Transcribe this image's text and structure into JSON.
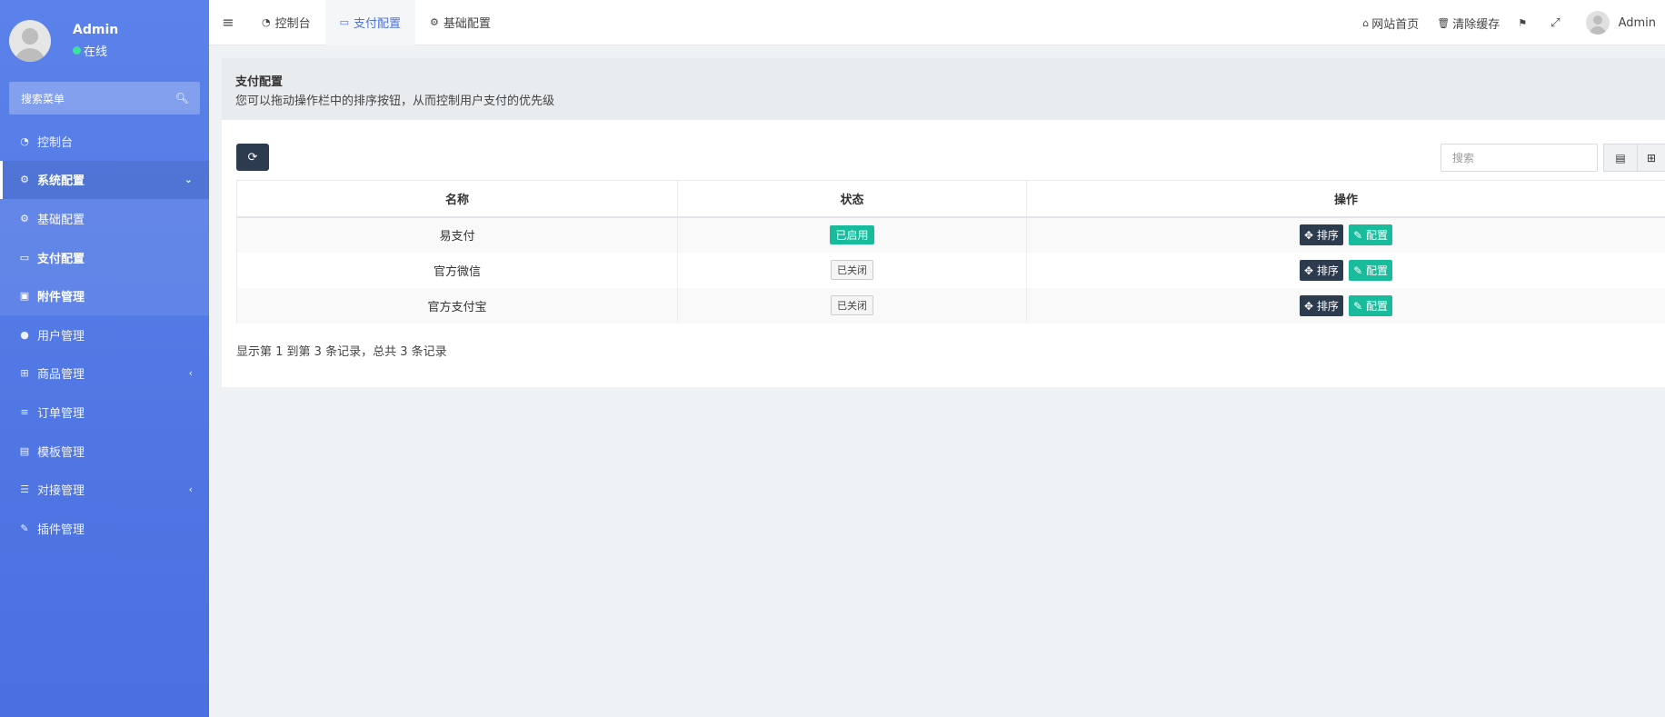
{
  "sidebar": {
    "user_name": "Admin",
    "user_status": "在线",
    "search_placeholder": "搜索菜单",
    "items": [
      {
        "label": "控制台",
        "icon": "dashboard-icon"
      },
      {
        "label": "系统配置",
        "icon": "gear-icon",
        "expanded": true
      },
      {
        "label": "基础配置",
        "icon": "gear-icon"
      },
      {
        "label": "支付配置",
        "icon": "credit-card-icon",
        "active": true
      },
      {
        "label": "附件管理",
        "icon": "image-icon"
      },
      {
        "label": "用户管理",
        "icon": "user-icon"
      },
      {
        "label": "商品管理",
        "icon": "cart-icon"
      },
      {
        "label": "订单管理",
        "icon": "list-icon"
      },
      {
        "label": "模板管理",
        "icon": "template-icon"
      },
      {
        "label": "对接管理",
        "icon": "sliders-icon"
      },
      {
        "label": "插件管理",
        "icon": "plug-icon"
      }
    ]
  },
  "topbar": {
    "tabs": [
      {
        "label": "控制台",
        "icon": "dashboard-icon"
      },
      {
        "label": "支付配置",
        "icon": "credit-card-icon",
        "active": true
      },
      {
        "label": "基础配置",
        "icon": "gear-icon"
      }
    ],
    "home_label": "网站首页",
    "clear_cache_label": "清除缓存",
    "user_name": "Admin"
  },
  "content_header": {
    "title": "支付配置",
    "description": "您可以拖动操作栏中的排序按钮，从而控制用户支付的优先级"
  },
  "toolbar": {
    "search_placeholder": "搜索"
  },
  "table": {
    "headers": [
      "名称",
      "状态",
      "操作"
    ],
    "rows": [
      {
        "name": "易支付",
        "status": "已启用",
        "enabled": true
      },
      {
        "name": "官方微信",
        "status": "已关闭",
        "enabled": false
      },
      {
        "name": "官方支付宝",
        "status": "已关闭",
        "enabled": false
      }
    ],
    "sort_label": "排序",
    "config_label": "配置"
  },
  "footer": {
    "info": "显示第 1 到第 3 条记录，总共 3 条记录"
  },
  "colors": {
    "sidebar": "#4e73df",
    "accent_green": "#18bc9c",
    "dark_button": "#2c3b4e"
  }
}
